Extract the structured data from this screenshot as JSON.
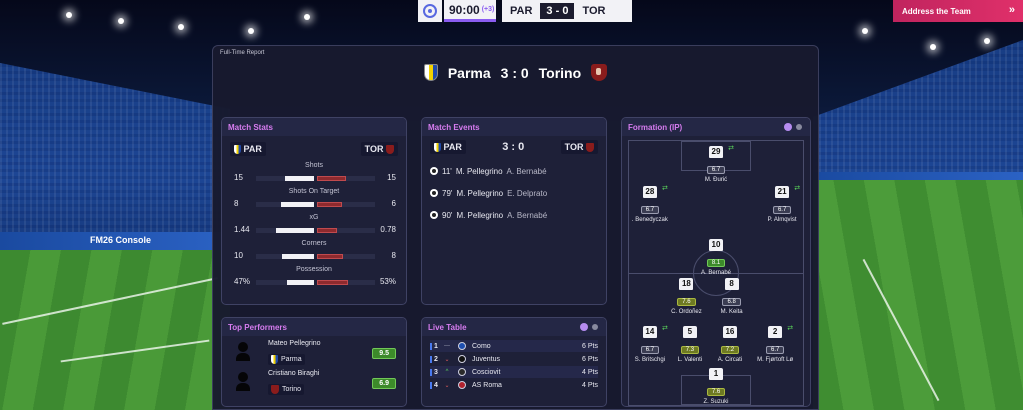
{
  "topbar": {
    "clock": "90:00",
    "added_time": "(+3)",
    "home_short": "PAR",
    "score": "3 - 0",
    "away_short": "TOR",
    "address_team": "Address the Team"
  },
  "report": {
    "title": "Full-Time Report",
    "home": "Parma",
    "away": "Torino",
    "score": "3 : 0"
  },
  "match_stats": {
    "title": "Match Stats",
    "home_short": "PAR",
    "away_short": "TOR",
    "rows": [
      {
        "label": "Shots",
        "home": "15",
        "away": "15",
        "home_share": 0.5,
        "away_share": 0.5
      },
      {
        "label": "Shots On Target",
        "home": "8",
        "away": "6",
        "home_share": 0.57,
        "away_share": 0.43
      },
      {
        "label": "xG",
        "home": "1.44",
        "away": "0.78",
        "home_share": 0.65,
        "away_share": 0.35
      },
      {
        "label": "Corners",
        "home": "10",
        "away": "8",
        "home_share": 0.56,
        "away_share": 0.44
      },
      {
        "label": "Possession",
        "home": "47%",
        "away": "53%",
        "home_share": 0.47,
        "away_share": 0.53
      }
    ]
  },
  "match_events": {
    "title": "Match Events",
    "home_short": "PAR",
    "away_short": "TOR",
    "score": "3 : 0",
    "events": [
      {
        "minute": "11'",
        "scorer": "M. Pellegrino",
        "assist": "A. Bernabé"
      },
      {
        "minute": "79'",
        "scorer": "M. Pellegrino",
        "assist": "E. Delprato"
      },
      {
        "minute": "90'",
        "scorer": "M. Pellegrino",
        "assist": "A. Bernabé"
      }
    ]
  },
  "top_performers": {
    "title": "Top Performers",
    "players": [
      {
        "name": "Mateo Pellegrino",
        "team": "Parma",
        "rating": "9.5"
      },
      {
        "name": "Cristiano Biraghi",
        "team": "Torino",
        "rating": "6.9"
      }
    ]
  },
  "live_table": {
    "title": "Live Table",
    "rows": [
      {
        "pos": "1",
        "change": "—",
        "team": "Como",
        "pts": "6 Pts",
        "badge_color": "#1e4fb0"
      },
      {
        "pos": "2",
        "change": "⌄",
        "team": "Juventus",
        "pts": "6 Pts",
        "badge_color": "#111111"
      },
      {
        "pos": "3",
        "change": "^",
        "team": "Cosciovit",
        "pts": "4 Pts",
        "badge_color": "#2a2a2a"
      },
      {
        "pos": "4",
        "change": "⌄",
        "team": "AS Roma",
        "pts": "4 Pts",
        "badge_color": "#b0222e"
      }
    ]
  },
  "formation": {
    "title": "Formation (IP)",
    "players": [
      {
        "number": "29",
        "rating": "6.7",
        "name": "M. Đurić",
        "tone": "n",
        "sub": true
      },
      {
        "number": "28",
        "rating": "6.7",
        "name": ". Benedyczak",
        "tone": "n",
        "sub": true
      },
      {
        "number": "21",
        "rating": "6.7",
        "name": "P. Almqvist",
        "tone": "n",
        "sub": true
      },
      {
        "number": "10",
        "rating": "8.1",
        "name": "A. Bernabé",
        "tone": "g",
        "sub": false
      },
      {
        "number": "18",
        "rating": "7.6",
        "name": "C. Ordoñez",
        "tone": "y",
        "sub": false
      },
      {
        "number": "8",
        "rating": "6.8",
        "name": "M. Keita",
        "tone": "n",
        "sub": false
      },
      {
        "number": "14",
        "rating": "6.7",
        "name": "S. Britschgi",
        "tone": "n",
        "sub": true
      },
      {
        "number": "5",
        "rating": "7.3",
        "name": "L. Valenti",
        "tone": "y",
        "sub": false
      },
      {
        "number": "16",
        "rating": "7.2",
        "name": "A. Circati",
        "tone": "y",
        "sub": false
      },
      {
        "number": "2",
        "rating": "6.7",
        "name": "M. Fjørtoft Lø",
        "tone": "n",
        "sub": true
      },
      {
        "number": "1",
        "rating": "7.6",
        "name": "Z. Suzuki",
        "tone": "y",
        "sub": false
      }
    ]
  },
  "backdrop": {
    "adboard": "FM26 Console"
  }
}
